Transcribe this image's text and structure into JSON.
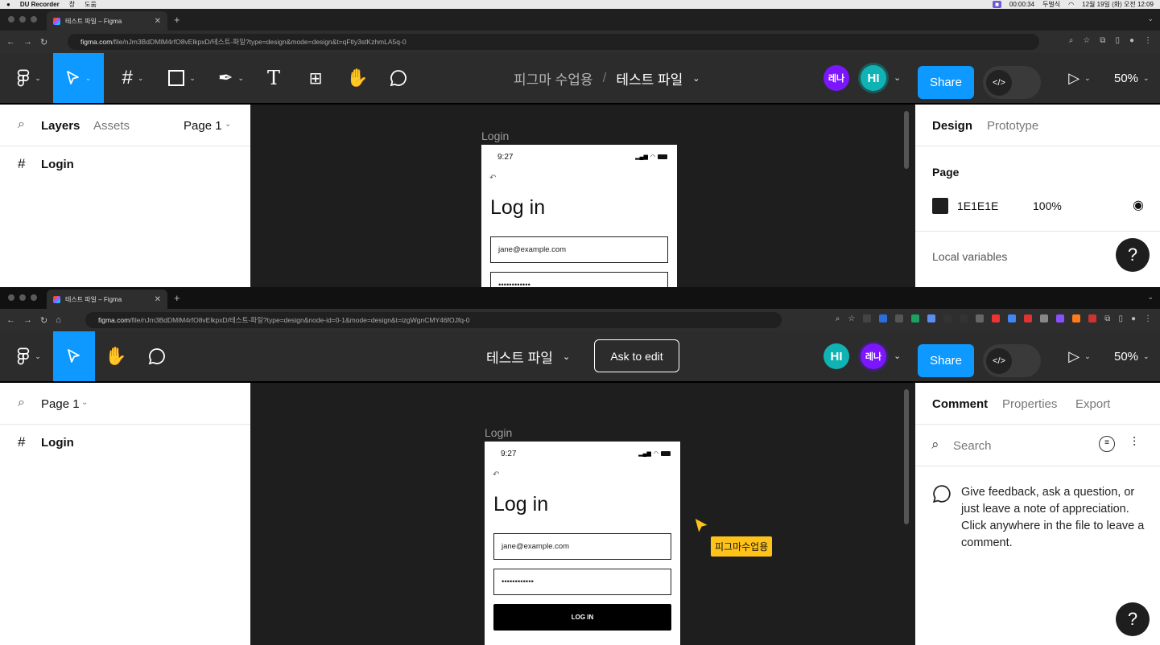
{
  "menubar": {
    "app": "DU Recorder",
    "items": [
      "창",
      "도움"
    ],
    "recorder_time": "00:00:34",
    "keyboard": "두벌식",
    "datetime": "12월 19일 (화) 오전 12:09"
  },
  "window1": {
    "tab_title": "테스트 파일 – Figma",
    "url_host": "figma.com",
    "url_path": "/file/nJm3BdDMlM4rfO8vElkpxD/테스트-파일?type=design&mode=design&t=qFtly3stKzhmLA5q-0",
    "breadcrumb_project": "피그마 수업용",
    "breadcrumb_sep": "/",
    "file_name": "테스트 파일",
    "avatar_1": "레나",
    "avatar_2": "HI",
    "share_label": "Share",
    "zoom": "50%",
    "left_tabs": {
      "layers": "Layers",
      "assets": "Assets",
      "page": "Page 1"
    },
    "layer_item": "Login",
    "right_tabs": {
      "design": "Design",
      "prototype": "Prototype"
    },
    "page_section": "Page",
    "page_color": "1E1E1E",
    "page_opacity": "100%",
    "local_variables": "Local variables",
    "help": "?",
    "frame_label": "Login",
    "phone": {
      "time": "9:27",
      "back": "↶",
      "title": "Log in",
      "email": "jane@example.com",
      "password": "••••••••••••"
    }
  },
  "window2": {
    "tab_title": "테스트 파일 – Figma",
    "url_host": "figma.com",
    "url_path": "/file/nJm3BdDMlM4rfO8vElkpxD/테스트-파일?type=design&node-id=0-1&mode=design&t=izgWgnCMY46fOJfq-0",
    "file_name": "테스트 파일",
    "ask_to_edit": "Ask to edit",
    "avatar_1": "HI",
    "avatar_2": "레나",
    "share_label": "Share",
    "zoom": "50%",
    "page": "Page 1",
    "layer_item": "Login",
    "right_tabs": {
      "comment": "Comment",
      "properties": "Properties",
      "export": "Export"
    },
    "search_placeholder": "Search",
    "comment_hint": "Give feedback, ask a question, or just leave a note of appreciation. Click anywhere in the file to leave a comment.",
    "help": "?",
    "frame_label": "Login",
    "cursor_label": "피그마수업용",
    "phone": {
      "time": "9:27",
      "back": "↶",
      "title": "Log in",
      "email": "jane@example.com",
      "password": "••••••••••••",
      "button": "LOG IN"
    }
  },
  "colors": {
    "accent": "#0d99ff",
    "toolbar": "#2c2c2c",
    "canvas": "#1e1e1e",
    "avatar_purple": "#7b16ff",
    "avatar_teal": "#10b3b3",
    "cursor_yellow": "#ffc21a"
  },
  "icons": [
    "figma-menu-icon",
    "move-tool-icon",
    "frame-tool-icon",
    "rectangle-tool-icon",
    "pen-tool-icon",
    "text-tool-icon",
    "resources-icon",
    "hand-tool-icon",
    "comment-tool-icon",
    "play-icon",
    "dev-mode-icon",
    "search-icon",
    "hash-icon",
    "eye-icon",
    "filter-icon",
    "settings-sliders-icon",
    "comment-bubble-icon"
  ]
}
